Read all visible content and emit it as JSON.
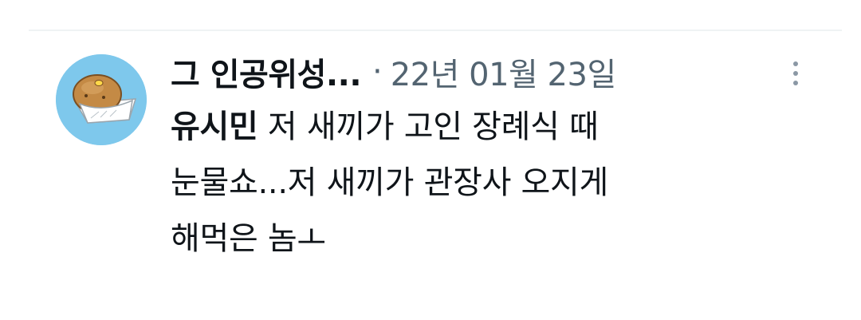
{
  "tweet": {
    "author": {
      "display_name": "그 인공위성...",
      "avatar_icon": "potato-character-avatar"
    },
    "separator": "·",
    "timestamp": "22년 01월 23일",
    "more_icon": "more-vertical-icon",
    "text": {
      "lead_bold": "유시민",
      "line1_rest": " 저 새끼가 고인 장례식 때",
      "line2": "눈물쇼...저 새끼가 관장사 오지게",
      "line3": "해먹은 놈ㅗ"
    }
  },
  "colors": {
    "primary_text": "#0f1419",
    "secondary_text": "#536471",
    "divider": "#eff3f4",
    "avatar_bg": "#7ec8ec"
  }
}
